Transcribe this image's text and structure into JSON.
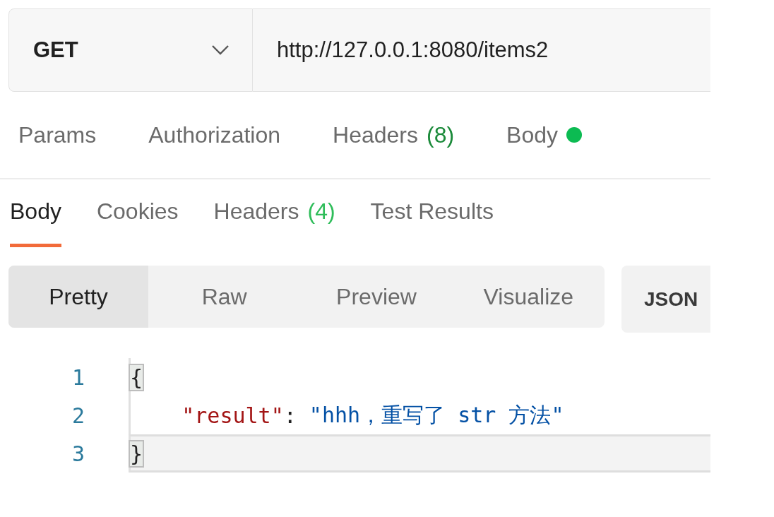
{
  "request": {
    "method": "GET",
    "url": "http://127.0.0.1:8080/items2"
  },
  "request_tabs": [
    {
      "label": "Params",
      "selected": false
    },
    {
      "label": "Authorization",
      "selected": false
    },
    {
      "label": "Headers",
      "count": "(8)",
      "selected": false
    },
    {
      "label": "Body",
      "has_content": true,
      "selected": false
    }
  ],
  "response_tabs": [
    {
      "label": "Body",
      "selected": true
    },
    {
      "label": "Cookies",
      "selected": false
    },
    {
      "label": "Headers",
      "count": "(4)",
      "selected": false
    },
    {
      "label": "Test Results",
      "selected": false
    }
  ],
  "view_modes": [
    {
      "label": "Pretty",
      "selected": true
    },
    {
      "label": "Raw",
      "selected": false
    },
    {
      "label": "Preview",
      "selected": false
    },
    {
      "label": "Visualize",
      "selected": false
    }
  ],
  "format": "JSON",
  "code_lines": [
    {
      "number": "1",
      "active": false,
      "tokens": [
        {
          "kind": "brace",
          "text": "{"
        }
      ]
    },
    {
      "number": "2",
      "active": false,
      "tokens": [
        {
          "kind": "key",
          "text": "\"result\""
        },
        {
          "kind": "punct",
          "text": ": "
        },
        {
          "kind": "string",
          "text": "\"hhh，重写了 str 方法\""
        }
      ]
    },
    {
      "number": "3",
      "active": true,
      "tokens": [
        {
          "kind": "brace",
          "text": "}"
        }
      ]
    }
  ]
}
